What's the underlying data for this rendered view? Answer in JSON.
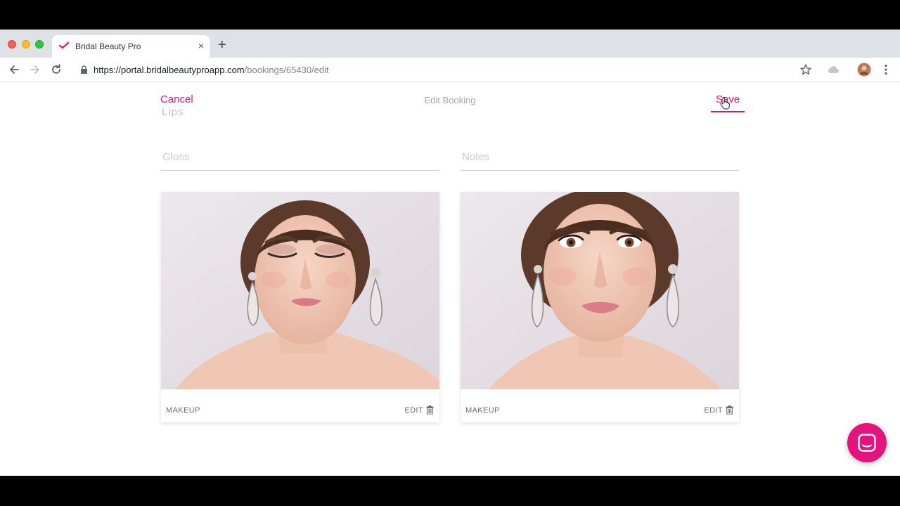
{
  "browser": {
    "tab_title": "Bridal Beauty Pro",
    "tab_close": "×",
    "new_tab": "+",
    "url_host": "https://portal.bridalbeautyproapp.com",
    "url_path": "/bookings/65430/edit"
  },
  "header": {
    "cancel_label": "Cancel",
    "title": "Edit Booking",
    "save_label": "Save"
  },
  "form": {
    "section_label": "Lips",
    "gloss_placeholder": "Gloss",
    "notes_placeholder": "Notes"
  },
  "photos": [
    {
      "caption": "MAKEUP",
      "edit_label": "EDIT",
      "subject": "bride-eyes-closed"
    },
    {
      "caption": "MAKEUP",
      "edit_label": "EDIT",
      "subject": "bride-eyes-open"
    }
  ],
  "colors": {
    "accent": "#e0127e",
    "chat_button": "#e6127d"
  },
  "icons": [
    "back-arrow-icon",
    "forward-arrow-icon",
    "reload-icon",
    "lock-icon",
    "star-icon",
    "cloud-icon",
    "avatar",
    "more-menu-icon",
    "trash-icon",
    "chat-icon"
  ]
}
